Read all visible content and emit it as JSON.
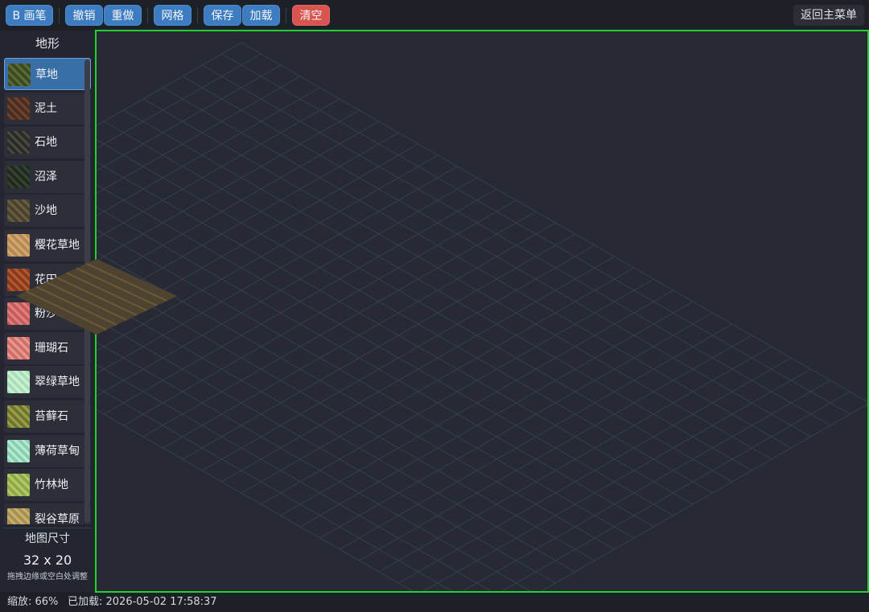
{
  "toolbar": {
    "brush_label": "B 画笔",
    "undo_label": "撤销",
    "redo_label": "重做",
    "grid_label": "网格",
    "save_label": "保存",
    "load_label": "加载",
    "clear_label": "清空",
    "back_label": "返回主菜单"
  },
  "sidebar": {
    "title": "地形",
    "items": [
      {
        "label": "草地",
        "color": "#3a4a26",
        "color2": "#5d6c33",
        "selected": true
      },
      {
        "label": "泥土",
        "color": "#4a2d1e",
        "color2": "#6b4330"
      },
      {
        "label": "石地",
        "color": "#2a2a26",
        "color2": "#4a4a40"
      },
      {
        "label": "沼泽",
        "color": "#1f2a1c",
        "color2": "#364330"
      },
      {
        "label": "沙地",
        "color": "#4a4230",
        "color2": "#6b5e3f"
      },
      {
        "label": "樱花草地",
        "color": "#b68a55",
        "color2": "#d4a870"
      },
      {
        "label": "花田",
        "color": "#8a3a1e",
        "color2": "#b35a30"
      },
      {
        "label": "粉沙",
        "color": "#c75a5a",
        "color2": "#e08080"
      },
      {
        "label": "珊瑚石",
        "color": "#d0706a",
        "color2": "#e8988f"
      },
      {
        "label": "翠绿草地",
        "color": "#a7e0b6",
        "color2": "#cff0d6"
      },
      {
        "label": "苔藓石",
        "color": "#6f7530",
        "color2": "#9aa048"
      },
      {
        "label": "薄荷草甸",
        "color": "#88d0b0",
        "color2": "#b8ead4"
      },
      {
        "label": "竹林地",
        "color": "#8fa848",
        "color2": "#b5c86a"
      },
      {
        "label": "裂谷草原",
        "color": "#a89050",
        "color2": "#c8b070"
      }
    ],
    "map_size_title": "地图尺寸",
    "map_size_value": "32 x 20",
    "map_size_hint": "拖拽边缘或空白处调整"
  },
  "status": {
    "zoom_text": "缩放: 66%",
    "loaded_text": "已加载: 2026-05-02 17:58:37"
  },
  "map": {
    "cols": 32,
    "rows": 20,
    "grid_color": "#3a3e4c",
    "painted_tile": {
      "col": 0,
      "row": 0,
      "color": "#4e4330",
      "stripe": "#6b5a38"
    }
  },
  "colors": {
    "accent": "#3d7cc0",
    "danger": "#d9534f",
    "canvas_border": "#22d12d"
  }
}
